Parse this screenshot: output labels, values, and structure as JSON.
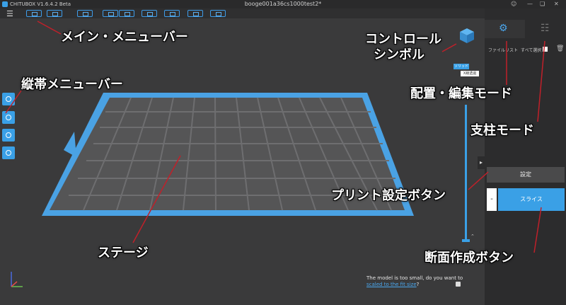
{
  "window": {
    "app_title": "CHITUBOX V1.6.4.2 Beta",
    "document_title": "booge001a36cs1000test2*",
    "controls": [
      "user-icon",
      "minimize-icon",
      "restore-icon",
      "close-icon"
    ]
  },
  "toolbar": {
    "menu_icon": "hamburger-icon",
    "buttons": [
      "open-icon",
      "save-icon",
      "export-icon",
      "undo-icon",
      "redo-icon",
      "layout-icon",
      "network-icon",
      "printer-icon",
      "fullscreen-icon"
    ]
  },
  "left_toolbar": {
    "buttons": [
      "move-icon",
      "rotate-icon",
      "scale-icon",
      "mirror-icon"
    ]
  },
  "view": {
    "solid_label": "ソリッド",
    "xray_label": "X線透過"
  },
  "right_panel": {
    "tabs": [
      "placement-edit-tab-icon",
      "support-tab-icon"
    ],
    "file_list_label": "ファイルリスト",
    "select_all_label": "すべて選択",
    "settings_button": "設定",
    "minus_button": "-",
    "slice_button": "スライス"
  },
  "message": {
    "text": "The model is too small, do you want to",
    "link": "scaled to the fit size",
    "suffix": "?"
  },
  "annotations": {
    "main_menubar": "メイン・メニューバー",
    "control_symbol_1": "コントロール",
    "control_symbol_2": "シンボル",
    "vertical_menubar": "縦帯メニューバー",
    "placement_edit_mode": "配置・編集モード",
    "support_mode": "支柱モード",
    "print_settings_button": "プリント設定ボタン",
    "stage": "ステージ",
    "slice_button": "断面作成ボタン"
  },
  "colors": {
    "accent": "#3aa0e6",
    "annotation_line": "#c0202a",
    "background": "#3a3a3b"
  }
}
